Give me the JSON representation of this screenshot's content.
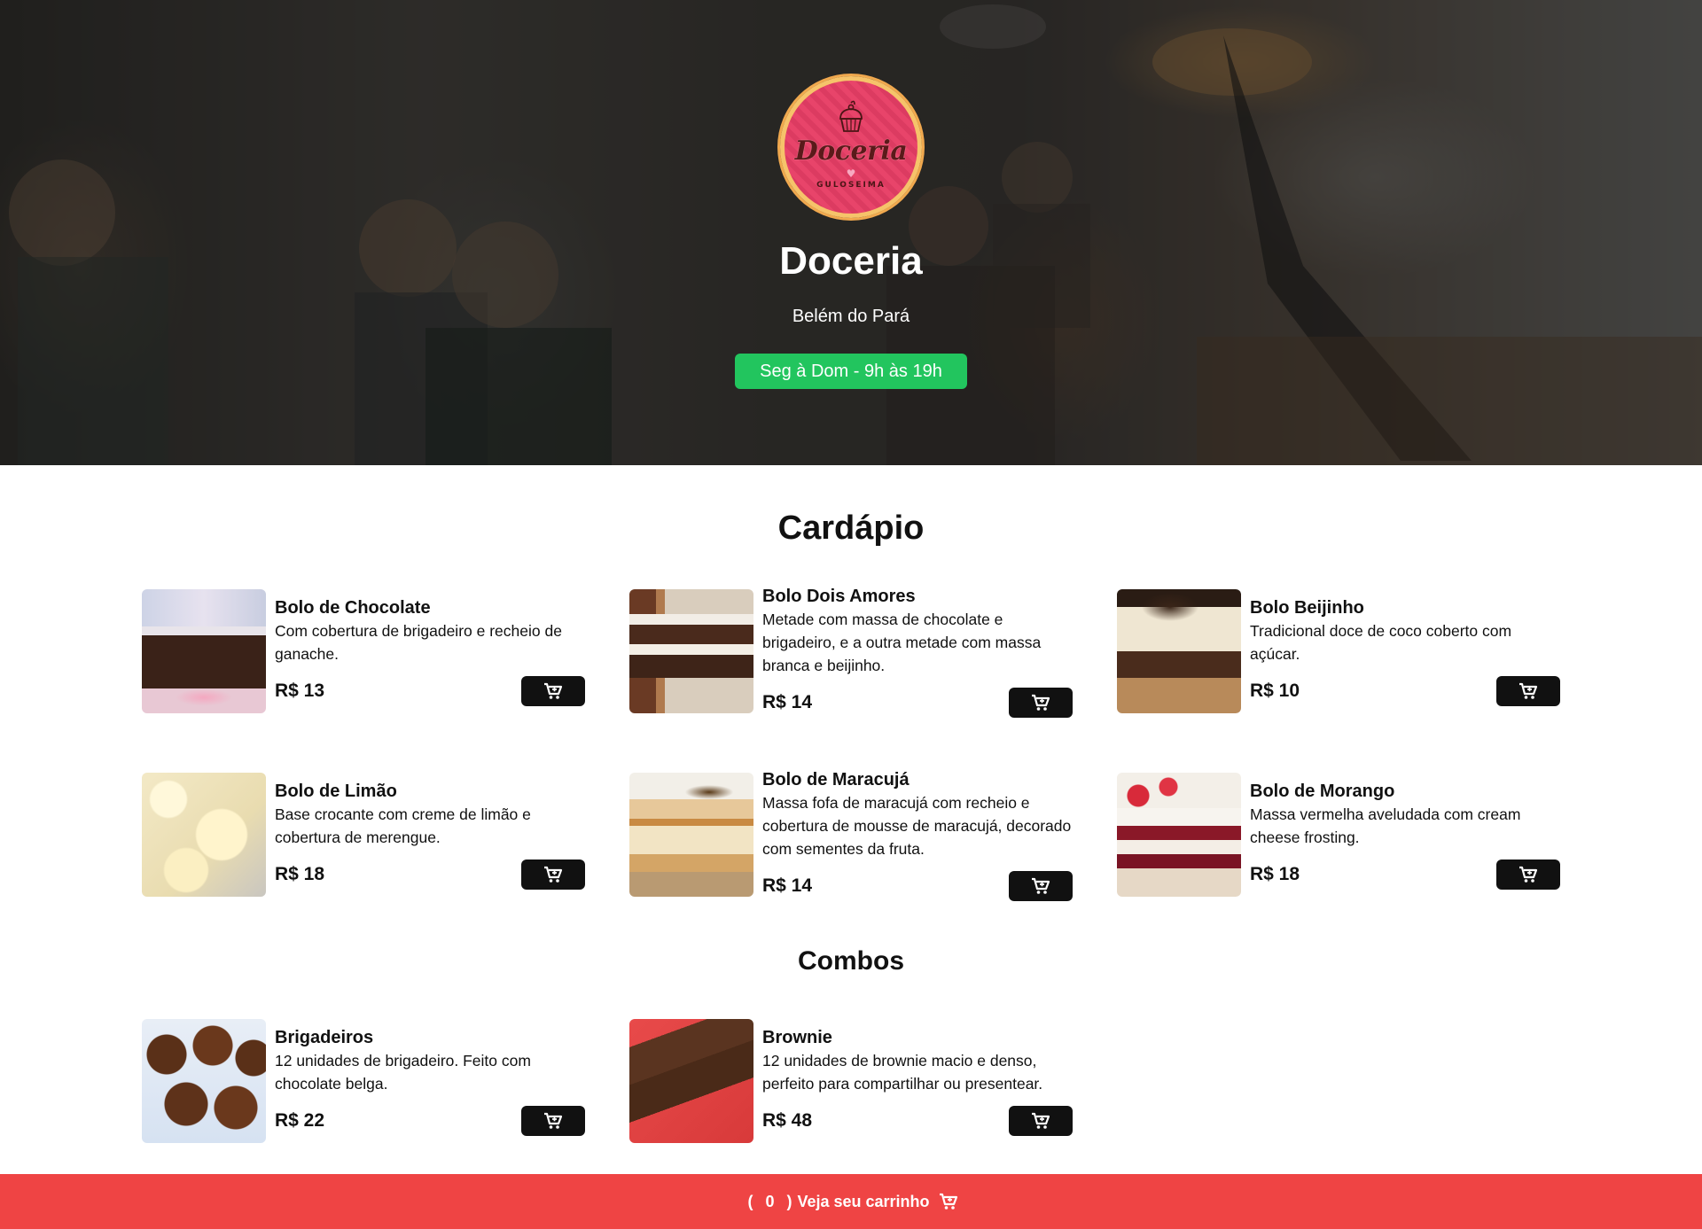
{
  "hero": {
    "logo": {
      "title": "Doceria",
      "subtitle": "GULOSEIMA",
      "icon": "cupcake-icon"
    },
    "title": "Doceria",
    "city": "Belém do Pará",
    "hours": "Seg à Dom - 9h às 19h"
  },
  "menu": {
    "title": "Cardápio",
    "items": [
      {
        "name": "Bolo de Chocolate",
        "description": "Com cobertura de brigadeiro e recheio de ganache.",
        "price": "R$ 13"
      },
      {
        "name": "Bolo Dois Amores",
        "description": "Metade com massa de chocolate e brigadeiro, e a outra metade com massa branca e beijinho.",
        "price": "R$ 14"
      },
      {
        "name": "Bolo Beijinho",
        "description": "Tradicional doce de coco coberto com açúcar.",
        "price": "R$ 10"
      },
      {
        "name": "Bolo de Limão",
        "description": "Base crocante com creme de limão e cobertura de merengue.",
        "price": "R$ 18"
      },
      {
        "name": "Bolo de Maracujá",
        "description": "Massa fofa de maracujá com recheio e cobertura de mousse de maracujá, decorado com sementes da fruta.",
        "price": "R$ 14"
      },
      {
        "name": "Bolo de Morango",
        "description": "Massa vermelha aveludada com cream cheese frosting.",
        "price": "R$ 18"
      }
    ]
  },
  "combos": {
    "title": "Combos",
    "items": [
      {
        "name": "Brigadeiros",
        "description": "12 unidades de brigadeiro. Feito com chocolate belga.",
        "price": "R$ 22"
      },
      {
        "name": "Brownie",
        "description": "12 unidades de brownie macio e denso, perfeito para compartilhar ou presentear.",
        "price": "R$ 48"
      }
    ]
  },
  "cart_bar": {
    "open_paren": "(",
    "count": "0",
    "close_paren": ")",
    "label": "Veja seu carrinho",
    "icon": "cart-icon"
  },
  "colors": {
    "hours_badge": "#22c55e",
    "cart_bar": "#ef4444",
    "cart_button": "#111111",
    "logo_pink": "#e8446a",
    "logo_ring": "#f6c36a"
  }
}
